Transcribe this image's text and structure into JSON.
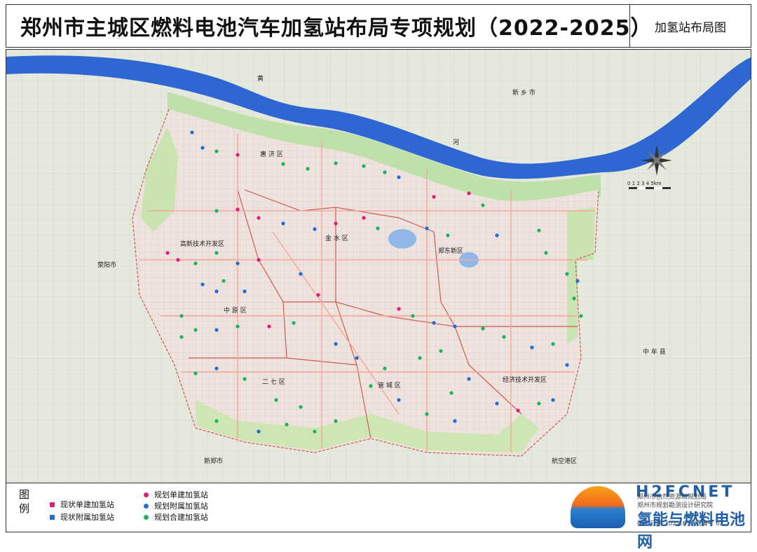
{
  "header": {
    "title": "郑州市主城区燃料电池汽车加氢站布局专项规划（2022-2025）",
    "subtitle": "加氢站布局图"
  },
  "map": {
    "labels": {
      "river1": "黄",
      "river2": "河",
      "xinxiang": "新 乡 市",
      "huiji": "惠 济 区",
      "jinshui": "金 水 区",
      "zhengdong": "郑东新区",
      "gaoxin": "高新技术开发区",
      "xingyang": "荥阳市",
      "zhongyuan": "中 原 区",
      "erqi": "二 七 区",
      "guancheng": "管 城 区",
      "jingkai": "经济技术开发区",
      "zhongmou": "中 牟 县",
      "xinzheng": "新郑市",
      "hangkonggang": "航空港区",
      "scale": "0  1  2  3  4  5km"
    },
    "colors": {
      "existing_standalone": "#e4197a",
      "existing_attached": "#1d6fd8",
      "planned_standalone": "#e4197a",
      "planned_attached": "#1d6fd8",
      "planned_combined": "#18b55a"
    }
  },
  "legend": {
    "title": "图例",
    "items": [
      {
        "label": "现状单建加氢站",
        "shape": "square",
        "color": "#e4197a"
      },
      {
        "label": "现状附属加氢站",
        "shape": "square",
        "color": "#1d6fd8"
      },
      {
        "label": "规划单建加氢站",
        "shape": "circle",
        "color": "#e4197a"
      },
      {
        "label": "规划附属加氢站",
        "shape": "circle",
        "color": "#1d6fd8"
      },
      {
        "label": "规划合建加氢站",
        "shape": "circle",
        "color": "#18b55a"
      }
    ]
  },
  "footer": {
    "org1": "郑州市自然资源和规划局",
    "org2": "郑州市规划勘测设计研究院",
    "date_label": "编制日期 2022.6 图纸编号 02",
    "watermark_brand": "H2FCNET",
    "watermark_cn": "氢能与燃料电池网"
  }
}
